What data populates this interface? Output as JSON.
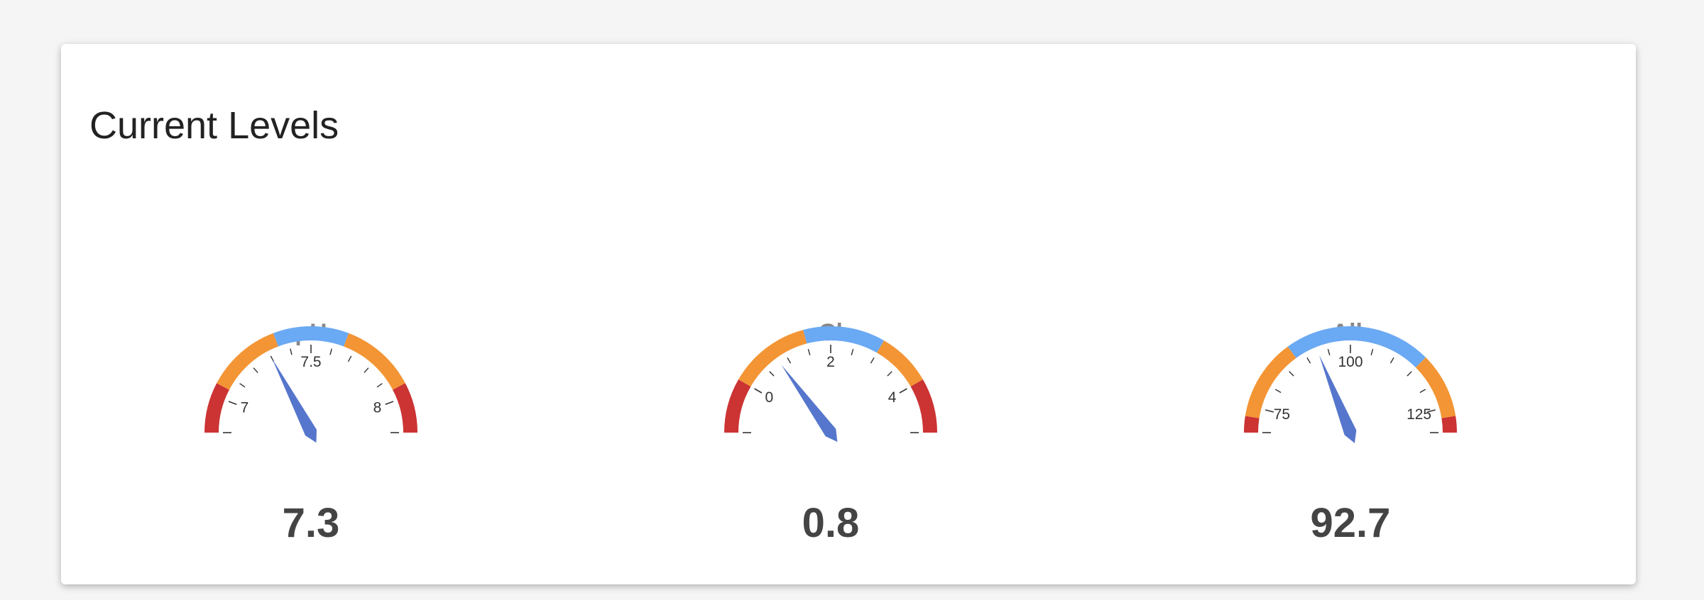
{
  "panel": {
    "title": "Current Levels"
  },
  "gauges": [
    {
      "id": "ph",
      "label": "pH",
      "value": 7.3,
      "value_text": "7.3",
      "needle_value": 7.3,
      "min": 6.85,
      "max": 8.15,
      "min_label": "7",
      "mid_label": "7.5",
      "max_label": "8",
      "label_values": [
        7,
        7.5,
        8
      ],
      "minor_ticks": [
        7.1,
        7.2,
        7.3,
        7.4,
        7.6,
        7.7,
        7.8,
        7.9
      ],
      "major_ticks": [
        6.85,
        7,
        7.5,
        8,
        8.15
      ],
      "bands": [
        {
          "from": 6.85,
          "to": 7.05,
          "color": "#cc3333"
        },
        {
          "from": 7.05,
          "to": 7.35,
          "color": "#f39535"
        },
        {
          "from": 7.35,
          "to": 7.65,
          "color": "#6aa9f3"
        },
        {
          "from": 7.65,
          "to": 7.95,
          "color": "#f39535"
        },
        {
          "from": 7.95,
          "to": 8.15,
          "color": "#cc3333"
        }
      ]
    },
    {
      "id": "cl",
      "label": "Cl",
      "value": 0.8,
      "value_text": "0.8",
      "needle_value": 0.8,
      "min": -1,
      "max": 5,
      "min_label": "0",
      "mid_label": "2",
      "max_label": "4",
      "label_values": [
        0,
        2,
        4
      ],
      "minor_ticks": [
        0.5,
        1,
        1.5,
        2.5,
        3,
        3.5
      ],
      "major_ticks": [
        -1,
        0,
        2,
        4,
        5
      ],
      "bands": [
        {
          "from": -1,
          "to": 0,
          "color": "#cc3333"
        },
        {
          "from": 0,
          "to": 1.5,
          "color": "#f39535"
        },
        {
          "from": 1.5,
          "to": 3,
          "color": "#6aa9f3"
        },
        {
          "from": 3,
          "to": 4,
          "color": "#f39535"
        },
        {
          "from": 4,
          "to": 5,
          "color": "#cc3333"
        }
      ]
    },
    {
      "id": "alk",
      "label": "Alk",
      "value": 92.7,
      "value_text": "92.7",
      "needle_value": 92.7,
      "min": 70,
      "max": 130,
      "min_label": "75",
      "mid_label": "100",
      "max_label": "125",
      "label_values": [
        75,
        100,
        125
      ],
      "minor_ticks": [
        80,
        85,
        90,
        95,
        105,
        110,
        115,
        120
      ],
      "major_ticks": [
        70,
        75,
        100,
        125,
        130
      ],
      "bands": [
        {
          "from": 70,
          "to": 73,
          "color": "#cc3333"
        },
        {
          "from": 73,
          "to": 88,
          "color": "#f39535"
        },
        {
          "from": 88,
          "to": 115,
          "color": "#6aa9f3"
        },
        {
          "from": 115,
          "to": 127,
          "color": "#f39535"
        },
        {
          "from": 127,
          "to": 130,
          "color": "#cc3333"
        }
      ]
    }
  ],
  "colors": {
    "needle": "#5576cc",
    "label": "#888888",
    "value": "#444444",
    "tick": "#333333"
  }
}
